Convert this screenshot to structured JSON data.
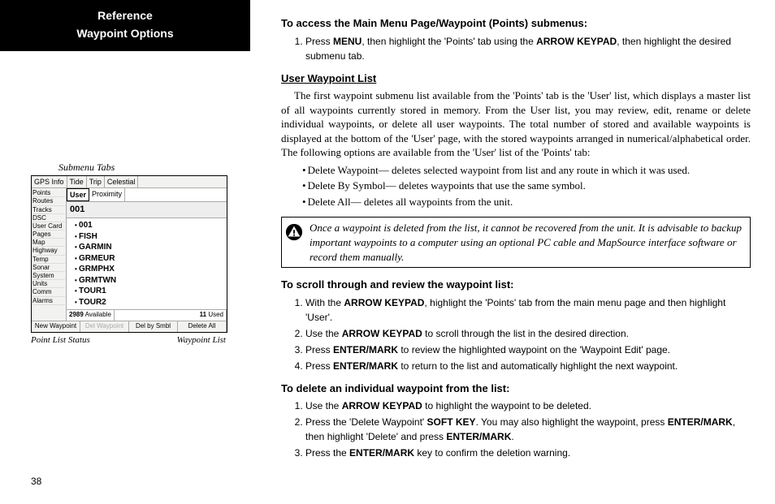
{
  "header": {
    "line1": "Reference",
    "line2": "Waypoint Options"
  },
  "left": {
    "submenu_label": "Submenu Tabs",
    "caption_left": "Point List Status",
    "caption_right": "Waypoint List",
    "screenshot": {
      "tabs": [
        "GPS Info",
        "Tide",
        "Trip",
        "Celestial"
      ],
      "tabs2": [
        "User",
        "Proximity"
      ],
      "side_items": [
        "Points",
        "Routes",
        "Tracks",
        "DSC",
        "User Card",
        "Pages",
        "Map",
        "Highway",
        "Temp",
        "Sonar",
        "System",
        "Units",
        "Comm",
        "Alarms"
      ],
      "num_001": "001",
      "waypoints": [
        "001",
        "FISH",
        "GARMIN",
        "GRMEUR",
        "GRMPHX",
        "GRMTWN",
        "TOUR1",
        "TOUR2"
      ],
      "status_available_num": "2989",
      "status_available_lbl": "Available",
      "status_used_num": "11",
      "status_used_lbl": "Used",
      "btn1": "New Waypoint",
      "btn2": "Del Waypoint",
      "btn3": "Del by Smbl",
      "btn4": "Delete All"
    }
  },
  "page_number": "38",
  "content": {
    "sec1_title": "To access the Main Menu Page/Waypoint (Points) submenus:",
    "sec1_steps": [
      {
        "pre": "Press ",
        "b1": "MENU",
        "mid": ", then highlight the 'Points' tab using the ",
        "b2": "ARROW KEYPAD",
        "post": ", then highlight the desired submenu tab."
      }
    ],
    "uwl_heading": "User Waypoint List",
    "uwl_para": "The first waypoint submenu list available from the 'Points' tab is the 'User' list, which displays a master list of all waypoints currently stored in memory. From the User list, you may review, edit, rename or delete individual waypoints, or delete all user waypoints. The total number of stored and available waypoints is displayed at the bottom of the 'User' page, with the stored waypoints arranged in numerical/alphabetical order. The following options are available from the 'User' list of the 'Points' tab:",
    "bullets": [
      "Delete Waypoint— deletes selected waypoint from list and any route in which it was used.",
      "Delete By Symbol— deletes waypoints that use the same symbol.",
      "Delete All— deletes all waypoints from the unit."
    ],
    "warning": "Once a waypoint is deleted from the list, it cannot be recovered from the unit. It is advisable to backup important waypoints to a computer using an optional PC cable and MapSource interface software or record them manually.",
    "sec2_title": "To scroll through and review the waypoint list:",
    "sec2_steps": [
      {
        "pre": "With the ",
        "b1": "ARROW KEYPAD",
        "post": ", highlight the 'Points' tab from the main menu page and then highlight 'User'."
      },
      {
        "pre": "Use the ",
        "b1": "ARROW KEYPAD",
        "post": " to scroll through the list in the desired direction."
      },
      {
        "pre": "Press ",
        "b1": "ENTER/MARK",
        "post": " to review the highlighted waypoint on the 'Waypoint Edit' page."
      },
      {
        "pre": "Press ",
        "b1": "ENTER/MARK",
        "post": " to return to the list and automatically highlight the next waypoint."
      }
    ],
    "sec3_title": "To delete an individual waypoint from the list:",
    "sec3_steps": [
      {
        "pre": "Use the ",
        "b1": "ARROW KEYPAD",
        "post": " to highlight the waypoint to be deleted."
      },
      {
        "pre": "Press the 'Delete Waypoint' ",
        "b1": "SOFT KEY",
        "mid": ". You may also highlight the waypoint, press ",
        "b2": "ENTER/MARK",
        "mid2": ", then highlight 'Delete' and press ",
        "b3": "ENTER/MARK",
        "post": "."
      },
      {
        "pre": "Press the ",
        "b1": "ENTER/MARK",
        "post": " key to confirm the deletion warning."
      }
    ]
  }
}
